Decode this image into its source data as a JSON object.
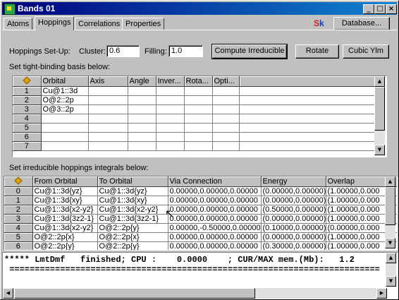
{
  "window": {
    "title": "Bands 01"
  },
  "tabs": [
    "Atoms",
    "Hoppings",
    "Correlations",
    "Properties"
  ],
  "active_tab": "Hoppings",
  "logo": {
    "s": "S",
    "k": "k"
  },
  "database_button": "Database...",
  "setup": {
    "label": "Hoppings Set-Up:",
    "cluster_label": "Cluster:",
    "cluster_value": "0.6",
    "filling_label": "Filling:",
    "filling_value": "1.0",
    "compute_button": "Compute Irreducible",
    "rotate_button": "Rotate",
    "cubic_button": "Cubic Ylm"
  },
  "basis": {
    "label": "Set tight-binding basis below:",
    "columns": [
      "Orbital",
      "Axis",
      "Angle",
      "Inver...",
      "Rota...",
      "Opti..."
    ],
    "rows": [
      {
        "n": "1",
        "orbital": "Cu@1::3d"
      },
      {
        "n": "2",
        "orbital": "O@2::2p"
      },
      {
        "n": "3",
        "orbital": "O@3::2p"
      },
      {
        "n": "4",
        "orbital": ""
      },
      {
        "n": "5",
        "orbital": ""
      },
      {
        "n": "6",
        "orbital": ""
      },
      {
        "n": "7",
        "orbital": ""
      }
    ]
  },
  "hoppings": {
    "label": "Set irreducible hoppings integrals below:",
    "columns": [
      "From Orbital",
      "To Orbital",
      "Via Connection",
      "Energy",
      "Overlap"
    ],
    "rows": [
      {
        "n": "0",
        "from": "Cu@1::3d{yz}",
        "to": "Cu@1::3d{yz}",
        "via": "0.00000,0.00000,0.00000",
        "energy": "(0.00000,0.00000)",
        "overlap": "(1.00000,0.000"
      },
      {
        "n": "1",
        "from": "Cu@1::3d{xy}",
        "to": "Cu@1::3d{xy}",
        "via": "0.00000,0.00000,0.00000",
        "energy": "(0.00000,0.00000)",
        "overlap": "(1.00000,0.000"
      },
      {
        "n": "2",
        "from": "Cu@1::3d{x2-y2}",
        "to": "Cu@1::3d{x2-y2}",
        "via": "0.00000,0.00000,0.00000",
        "energy": "(0.50000,0.00000)",
        "overlap": "(1.00000,0.000"
      },
      {
        "n": "3",
        "from": "Cu@1::3d{3z2-1}",
        "to": "Cu@1::3d{3z2-1}",
        "via": "0.00000,0.00000,0.00000",
        "energy": "(0.00000,0.00000)",
        "overlap": "(1.00000,0.000"
      },
      {
        "n": "4",
        "from": "Cu@1::3d{x2-y2}",
        "to": "O@2::2p{y}",
        "via": "0.00000,-0.50000,0.00000",
        "energy": "(0.10000,0.00000)",
        "overlap": "(0.00000,0.000"
      },
      {
        "n": "5",
        "from": "O@2::2p{x}",
        "to": "O@2::2p{x}",
        "via": "0.00000,0.00000,0.00000",
        "energy": "(0.00000,0.00000)",
        "overlap": "(1.00000,0.000"
      },
      {
        "n": "6",
        "from": "O@2::2p{y}",
        "to": "O@2::2p{y}",
        "via": "0.00000,0.00000,0.00000",
        "energy": "(0.30000,0.00000)",
        "overlap": "(1.00000,0.000"
      }
    ]
  },
  "console": {
    "line1": "***** LmtDmf   finished; CPU :    0.0000    ; CUR/MAX mem.(Mb):   1.2",
    "line2": " ========================================================================="
  }
}
